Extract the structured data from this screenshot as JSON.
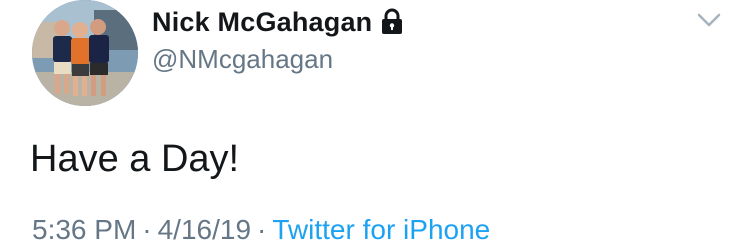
{
  "author": {
    "display_name": "Nick McGahagan",
    "handle": "@NMcgahagan",
    "protected_icon": "lock-icon",
    "avatar_alt": "avatar photo"
  },
  "menu": {
    "icon": "chevron-down-icon"
  },
  "tweet": {
    "text": "Have a Day!"
  },
  "meta": {
    "time": "5:36 PM",
    "separator": "·",
    "date": "4/16/19",
    "source": "Twitter for iPhone"
  },
  "colors": {
    "text_primary": "#14171a",
    "text_secondary": "#657786",
    "link": "#1da1f2"
  }
}
